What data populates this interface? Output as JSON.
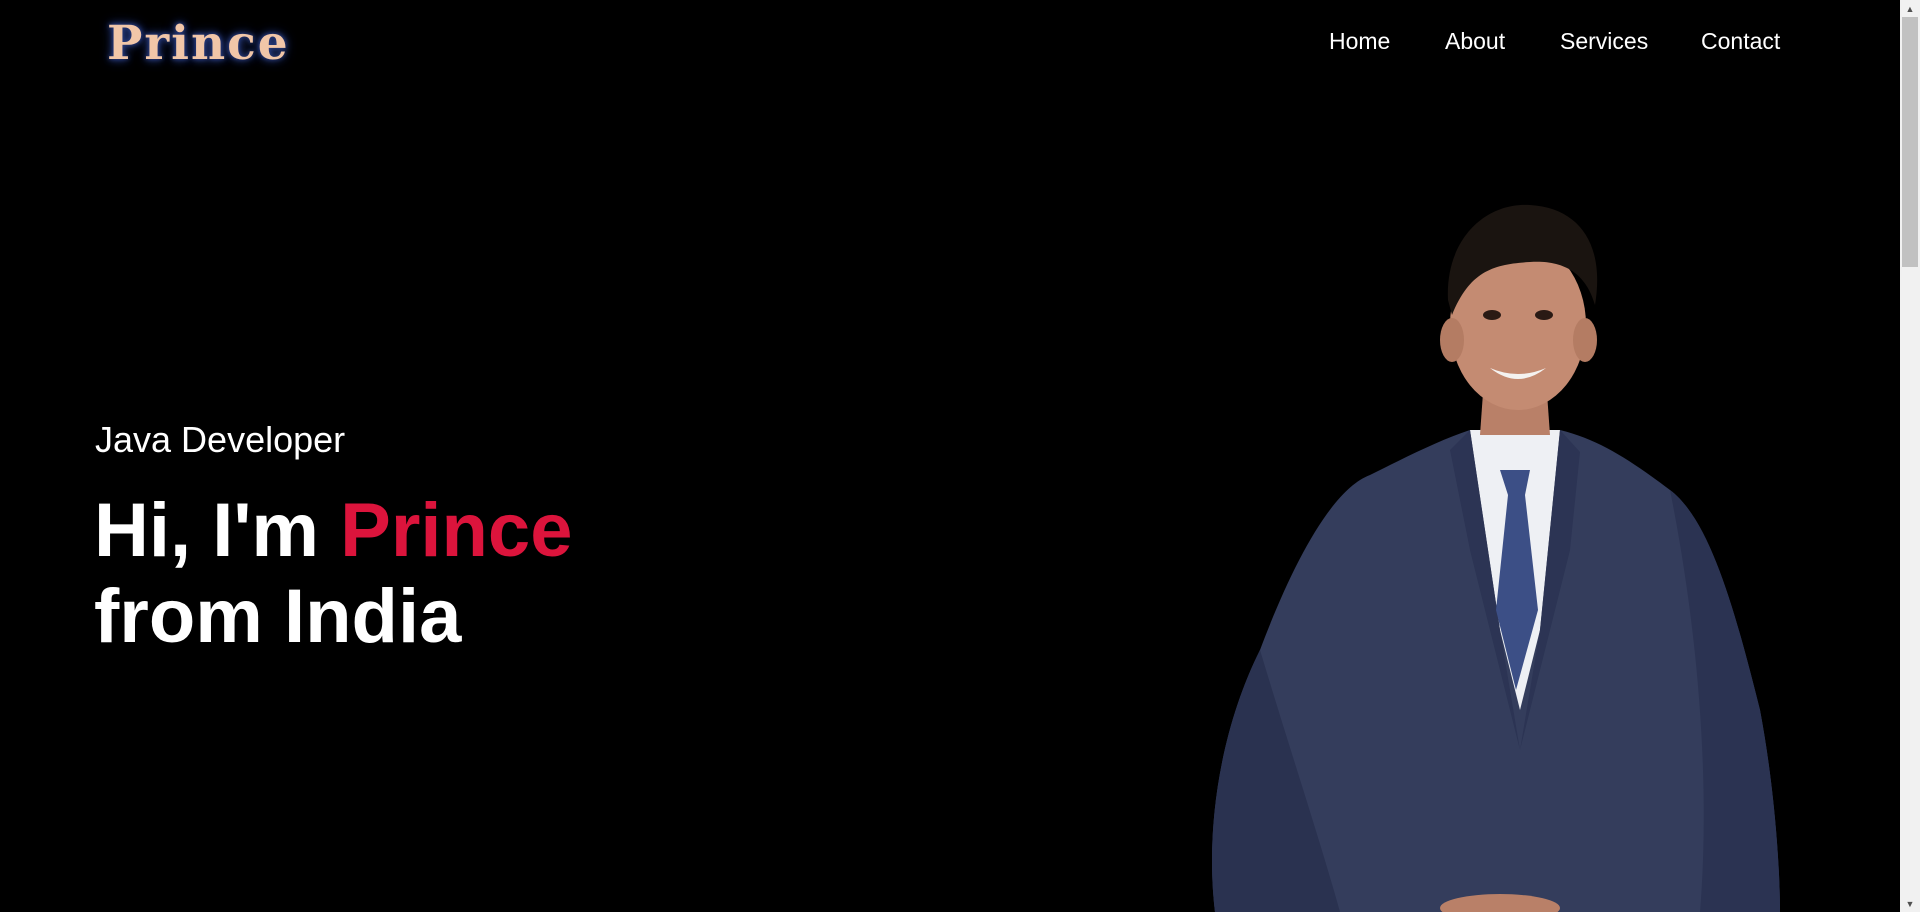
{
  "brand": {
    "logo_text": "Prince"
  },
  "nav": {
    "items": [
      {
        "label": "Home"
      },
      {
        "label": "About"
      },
      {
        "label": "Services"
      },
      {
        "label": "Contact"
      }
    ]
  },
  "hero": {
    "role": "Java Developer",
    "greeting": "Hi, I'm",
    "name": "Prince",
    "origin": "from India"
  },
  "colors": {
    "background": "#000000",
    "accent": "#dc143c",
    "logo_fill": "#f1c6a8",
    "logo_glow": "#2a3f86",
    "suit": "#343d5c"
  },
  "icons": {
    "scroll_up": "triangle-up-icon",
    "scroll_down": "triangle-down-icon"
  }
}
